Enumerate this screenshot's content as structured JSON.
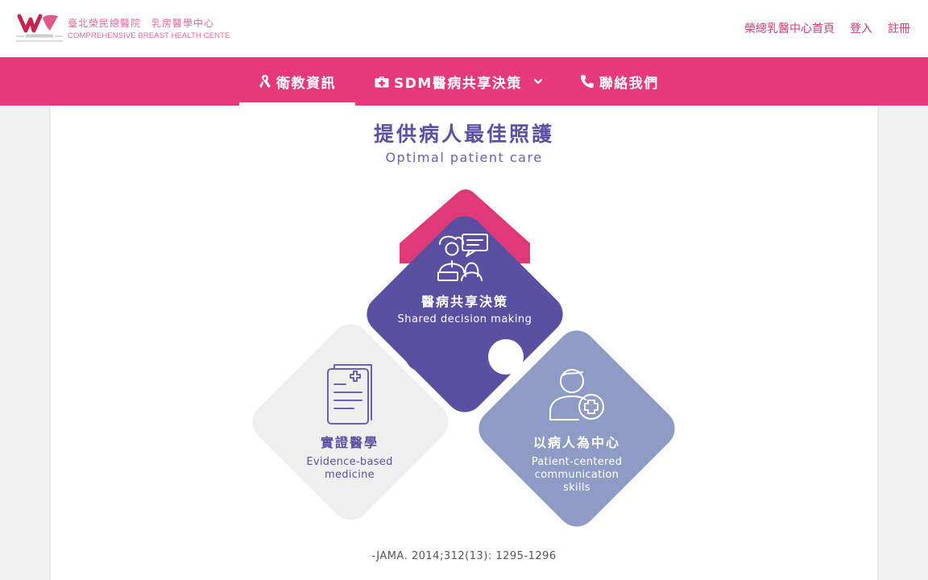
{
  "header": {
    "logo_cn": "臺北榮民總醫院　乳房醫學中心",
    "logo_en": "COMPREHENSIVE BREAST HEALTH CENTE",
    "links": [
      "榮總乳醫中心首頁",
      "登入",
      "註冊"
    ]
  },
  "nav": {
    "items": [
      {
        "label": "衛教資訊",
        "icon": "ribbon-icon",
        "active": true
      },
      {
        "label": "SDM醫病共享決策",
        "icon": "medical-kit-icon",
        "dropdown": true
      },
      {
        "label": "聯絡我們",
        "icon": "phone-icon"
      }
    ]
  },
  "infographic": {
    "title_cn": "提供病人最佳照護",
    "title_en": "Optimal patient care",
    "pieces": {
      "top": {
        "title": "醫病共享決策",
        "subtitle": "Shared decision making",
        "icon": "doctor-patient-icon"
      },
      "left": {
        "title": "實證醫學",
        "subtitle_lines": [
          "Evidence-based",
          "medicine"
        ],
        "icon": "clipboard-medical-icon"
      },
      "right": {
        "title": "以病人為中心",
        "subtitle_lines": [
          "Patient-centered",
          "communication",
          "skills"
        ],
        "icon": "patient-plus-icon"
      }
    },
    "citation": "-JAMA. 2014;312(13): 1295-1296"
  },
  "colors": {
    "brand_pink": "#e6397a",
    "link_pink": "#d63b73",
    "title_purple": "#5d4fa3",
    "top_piece": "#5a4fa1",
    "roof": "#e0397a",
    "left_piece": "#efefef",
    "right_piece": "#8e9bc5"
  }
}
